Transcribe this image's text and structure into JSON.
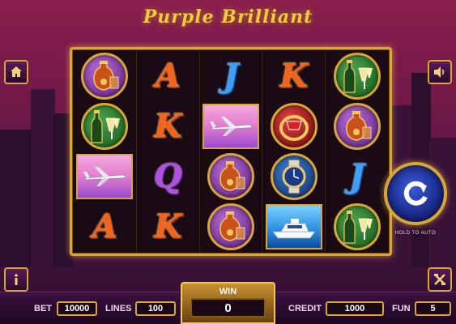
{
  "title": "Purple Brilliant",
  "reels": [
    [
      {
        "type": "coin",
        "icon": "cognac-icon",
        "color": "purple"
      },
      {
        "type": "coin",
        "icon": "champagne-icon",
        "color": "green"
      },
      {
        "type": "tile",
        "icon": "jet-icon",
        "style": "jet"
      },
      {
        "type": "letter",
        "letter": "A"
      }
    ],
    [
      {
        "type": "letter",
        "letter": "A"
      },
      {
        "type": "letter",
        "letter": "K"
      },
      {
        "type": "letter",
        "letter": "Q"
      },
      {
        "type": "letter",
        "letter": "K"
      }
    ],
    [
      {
        "type": "letter",
        "letter": "J"
      },
      {
        "type": "tile",
        "icon": "jet-icon",
        "style": "jet"
      },
      {
        "type": "coin",
        "icon": "cognac-icon",
        "color": "purple"
      },
      {
        "type": "coin",
        "icon": "cognac-icon",
        "color": "purple"
      }
    ],
    [
      {
        "type": "letter",
        "letter": "K"
      },
      {
        "type": "coin",
        "icon": "ring-icon",
        "color": "red"
      },
      {
        "type": "coin",
        "icon": "watch-icon",
        "color": "blue"
      },
      {
        "type": "tile",
        "icon": "yacht-icon",
        "style": "yacht"
      }
    ],
    [
      {
        "type": "coin",
        "icon": "champagne-icon",
        "color": "green"
      },
      {
        "type": "coin",
        "icon": "cognac-icon",
        "color": "purple"
      },
      {
        "type": "letter",
        "letter": "J"
      },
      {
        "type": "coin",
        "icon": "champagne-icon",
        "color": "green"
      }
    ]
  ],
  "buttons": {
    "home_icon": "home-icon",
    "sound_icon": "speaker-icon",
    "info_icon": "info-icon",
    "paytable_icon": "paytable-icon",
    "spin_icon": "spin-icon",
    "hold_label": "HOLD TO AUTO"
  },
  "bottom_bar": {
    "bet_label": "BET",
    "bet_value": "10000",
    "lines_label": "LINES",
    "lines_value": "100",
    "win_label": "WIN",
    "win_value": "0",
    "credit_label": "CREDIT",
    "credit_value": "1000",
    "fun_label": "FUN",
    "fun_value": "5"
  },
  "colors": {
    "gold": "#d8a637",
    "background": "#6e1848",
    "spin_blue": "#1a2a8a"
  }
}
